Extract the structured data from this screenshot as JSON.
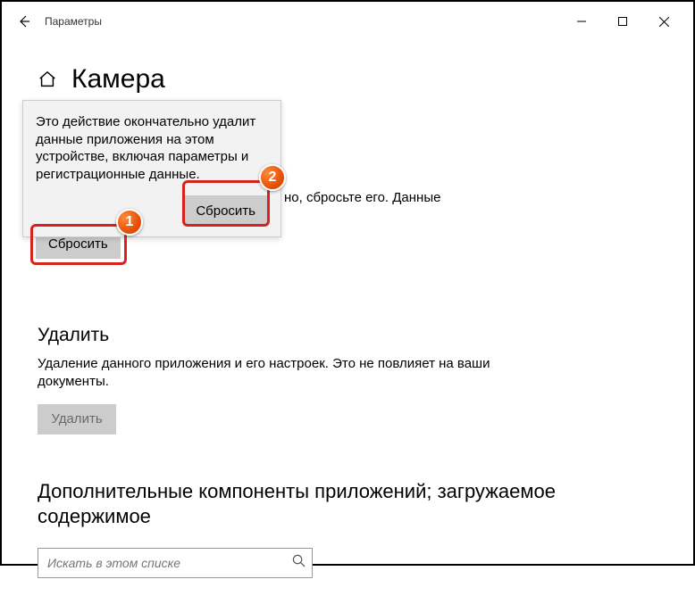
{
  "window": {
    "title": "Параметры"
  },
  "header": {
    "title": "Камера"
  },
  "flyout": {
    "text": "Это действие окончательно удалит данные приложения на этом устройстве, включая параметры и регистрационные данные.",
    "confirm_label": "Сбросить"
  },
  "reset": {
    "button_label": "Сбросить",
    "visible_text_fragment": "но, сбросьте его. Данные"
  },
  "delete": {
    "title": "Удалить",
    "desc": "Удаление данного приложения и его настроек. Это не повлияет на ваши документы.",
    "button_label": "Удалить"
  },
  "addons": {
    "title": "Дополнительные компоненты приложений; загружаемое содержимое"
  },
  "search": {
    "placeholder": "Искать в этом списке"
  },
  "annotations": {
    "badge1": "1",
    "badge2": "2"
  }
}
